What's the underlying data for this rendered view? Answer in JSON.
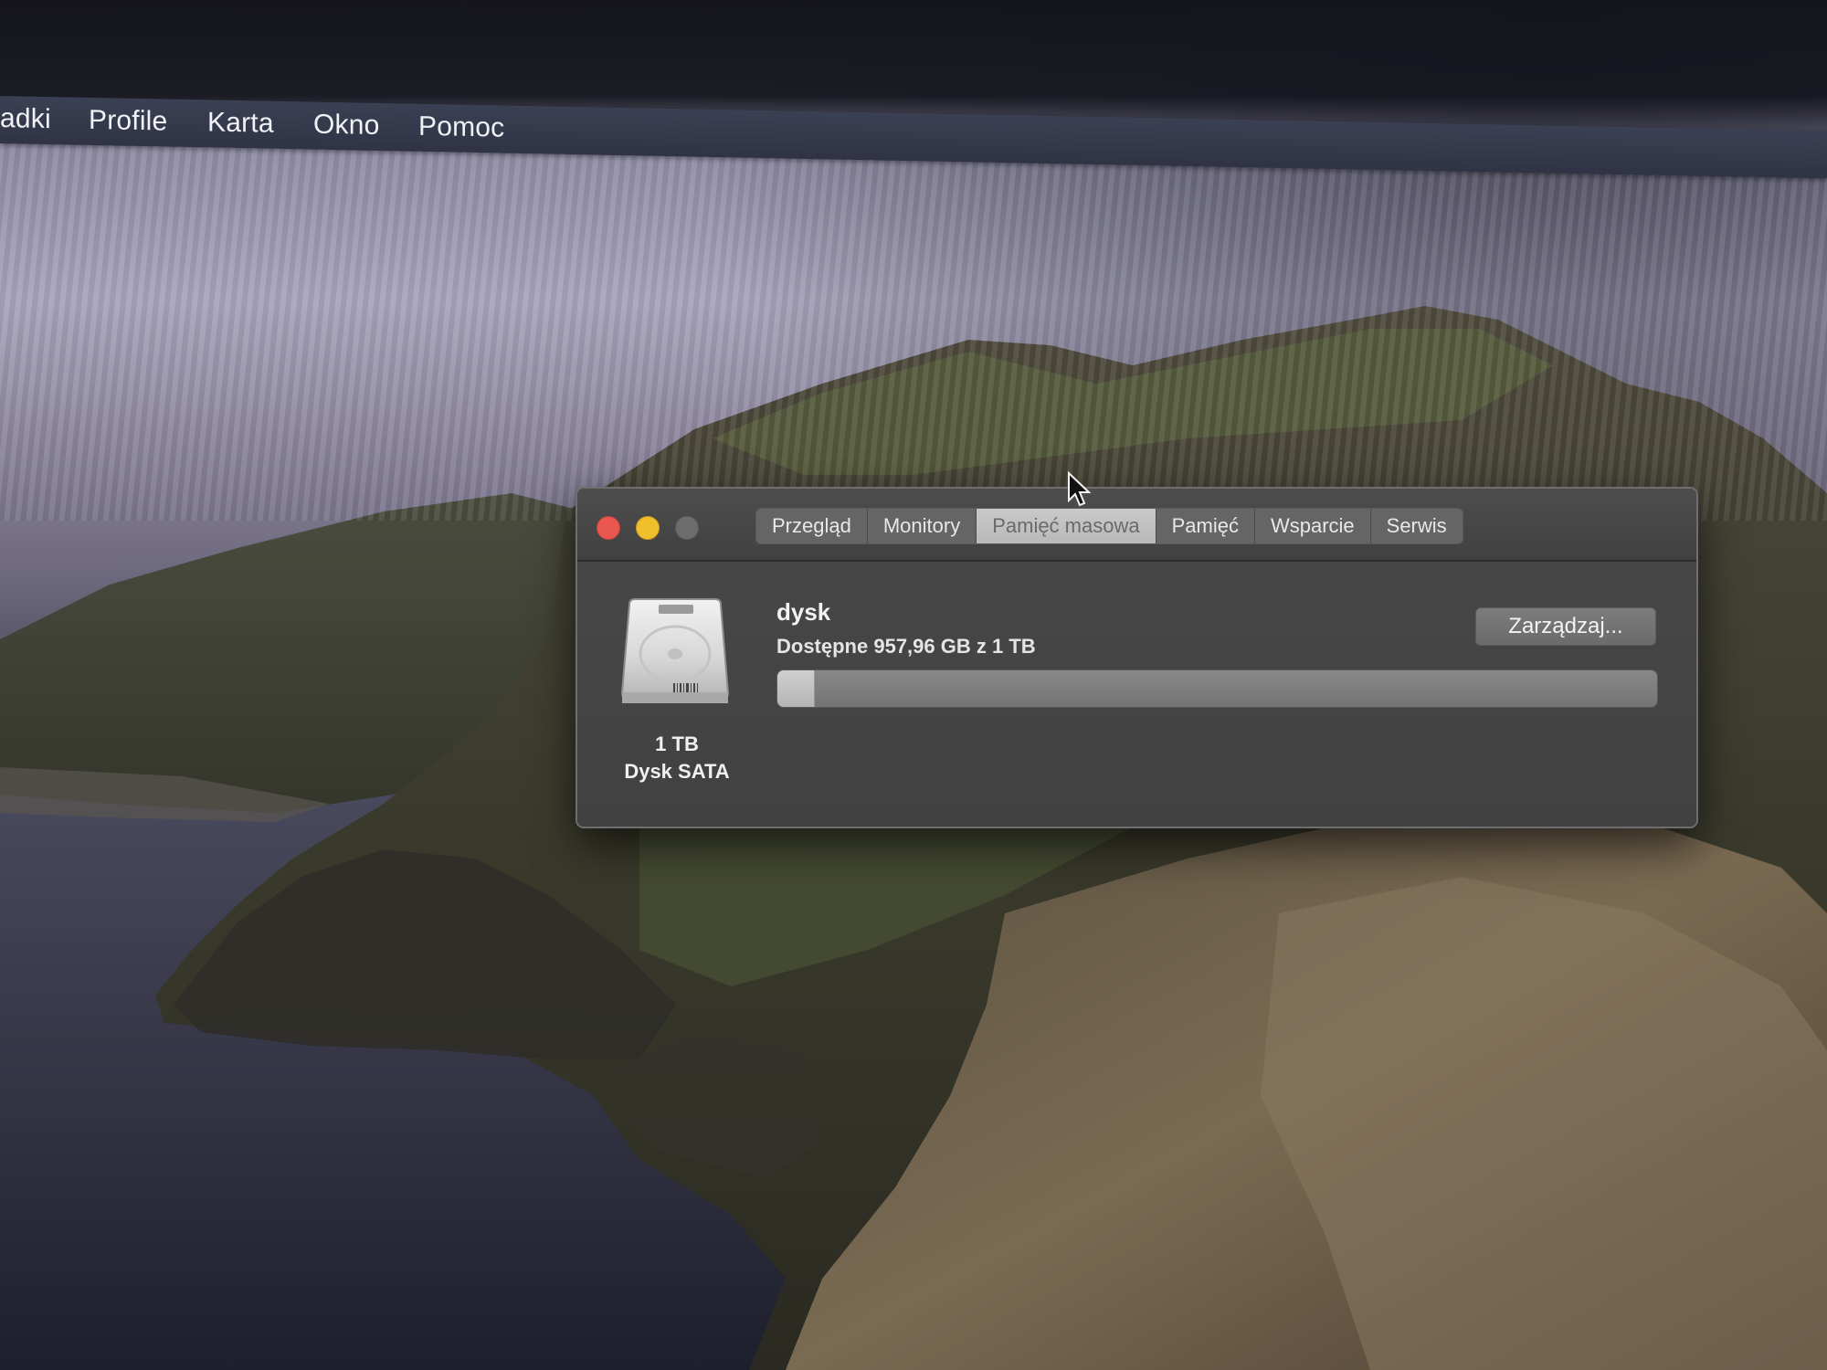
{
  "menubar": {
    "items": [
      "adki",
      "Profile",
      "Karta",
      "Okno",
      "Pomoc"
    ]
  },
  "window": {
    "controls": {
      "close_color": "#e9574f",
      "minimize_color": "#efbf2c",
      "zoom_color": "#6d6d6d"
    },
    "tabs": [
      {
        "label": "Przegląd",
        "active": false
      },
      {
        "label": "Monitory",
        "active": false
      },
      {
        "label": "Pamięć masowa",
        "active": true
      },
      {
        "label": "Pamięć",
        "active": false
      },
      {
        "label": "Wsparcie",
        "active": false
      },
      {
        "label": "Serwis",
        "active": false
      }
    ],
    "storage": {
      "disk_icon": "hard-drive-icon",
      "disk_size": "1 TB",
      "disk_type": "Dysk SATA",
      "volume_name": "dysk",
      "available_text": "Dostępne 957,96 GB z 1 TB",
      "used_fraction": 0.042,
      "manage_button": "Zarządzaj..."
    }
  },
  "cursor_icon": "arrow-pointer-icon"
}
